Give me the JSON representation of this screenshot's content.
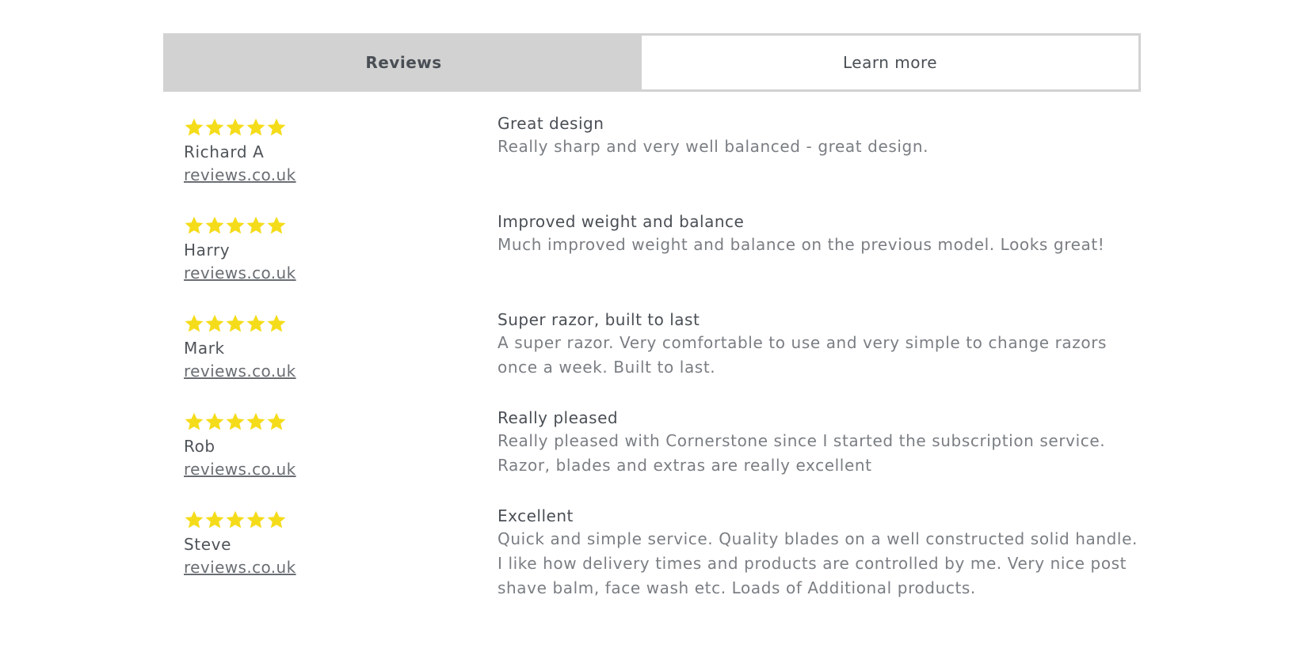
{
  "colors": {
    "star": "#f5dc1a",
    "tab_active_bg": "#d2d2d2",
    "text": "#4a4f55"
  },
  "tabs": [
    {
      "label": "Reviews",
      "active": true
    },
    {
      "label": "Learn more",
      "active": false
    }
  ],
  "reviews": [
    {
      "rating": 5,
      "author": "Richard A",
      "source": "reviews.co.uk",
      "title": "Great design",
      "body": "Really sharp and very well balanced - great design."
    },
    {
      "rating": 5,
      "author": "Harry",
      "source": "reviews.co.uk",
      "title": "Improved weight and balance",
      "body": "Much improved weight and balance on the previous model. Looks great!"
    },
    {
      "rating": 5,
      "author": "Mark",
      "source": "reviews.co.uk",
      "title": "Super razor, built to last",
      "body": "A super razor. Very comfortable to use and very simple to change razors once a week. Built to last."
    },
    {
      "rating": 5,
      "author": "Rob",
      "source": "reviews.co.uk",
      "title": "Really pleased",
      "body": "Really pleased with Cornerstone since I started the subscription service. Razor, blades and extras are really excellent"
    },
    {
      "rating": 5,
      "author": "Steve",
      "source": "reviews.co.uk",
      "title": "Excellent",
      "body": "Quick and simple service. Quality blades on a well constructed solid handle. I like how delivery times and products are controlled by me. Very nice post shave balm, face wash etc. Loads of Additional products."
    }
  ]
}
